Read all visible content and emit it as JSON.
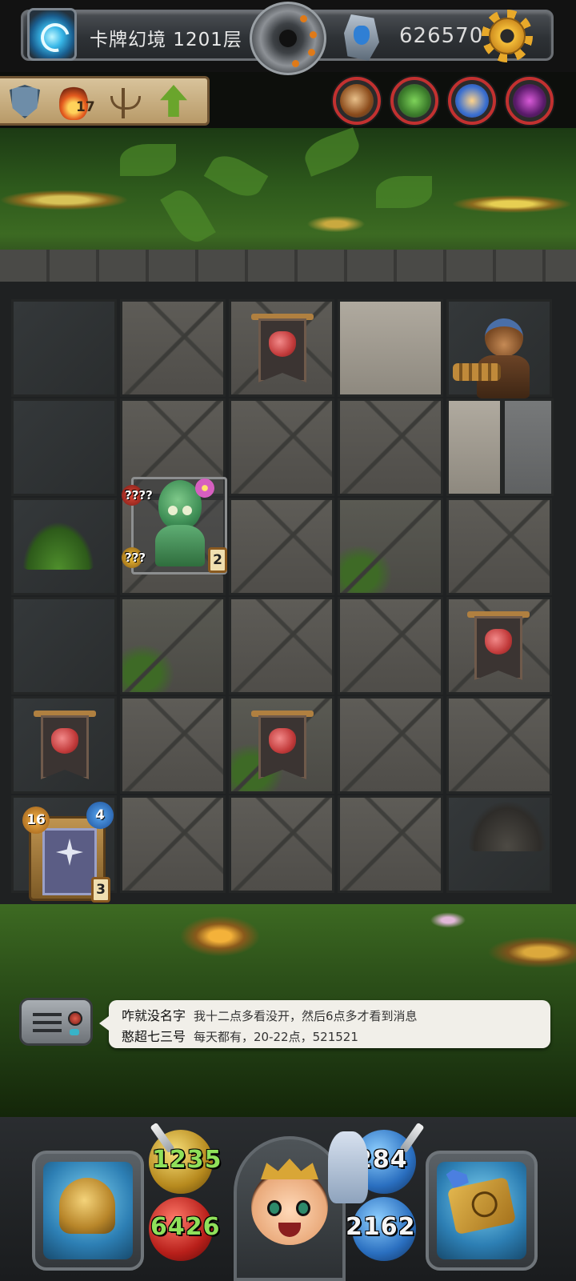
{
  "header": {
    "level_title": "卡牌幻境 1201层",
    "gold": "626570",
    "icons": [
      "portal-icon",
      "dial-icon",
      "crystal-icon",
      "gear-icon"
    ]
  },
  "status": {
    "flame_count": "17",
    "icons": [
      "shield-icon",
      "flame-icon",
      "candle-stand-icon",
      "upgrade-arrow-icon"
    ]
  },
  "party": [
    {
      "name": "party-member-1",
      "color": "#c23130"
    },
    {
      "name": "party-member-2",
      "color": "#c23130"
    },
    {
      "name": "party-member-3",
      "color": "#c23130"
    },
    {
      "name": "party-member-4",
      "color": "#c23130"
    }
  ],
  "dungeon": {
    "goblin": {
      "attack": "????",
      "hp": "???",
      "level": "2"
    },
    "card_stack": {
      "left_badge": "16",
      "right_badge": "4",
      "count": "3"
    }
  },
  "chat": {
    "messages": [
      {
        "sender": "咋就没名字",
        "text": "我十二点多看没开，然后6点多才看到消息"
      },
      {
        "sender": "憨超七三号",
        "text": "每天都有，20-22点，521521"
      }
    ]
  },
  "hud": {
    "attack": "1235",
    "hp": "6426",
    "defense": "284",
    "mana": "2162",
    "colors": {
      "attack_text": "#8fe05a",
      "hp_text": "#8fe05a",
      "defense_text": "#f4f4f4",
      "mana_text": "#f4f4f4"
    }
  }
}
